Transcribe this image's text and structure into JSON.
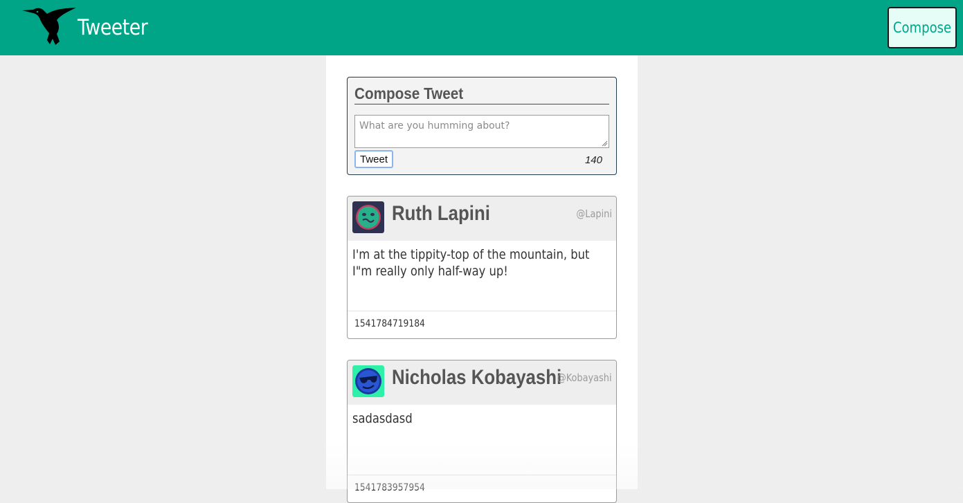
{
  "navbar": {
    "brand": "Tweeter",
    "compose_label": "Compose",
    "logo_icon": "hummingbird-icon",
    "background": "#00a587"
  },
  "compose": {
    "title": "Compose Tweet",
    "placeholder": "What are you humming about?",
    "value": "",
    "submit_label": "Tweet",
    "counter": "140"
  },
  "tweets": [
    {
      "name": "Ruth Lapini",
      "handle": "@Lapini",
      "text": "I'm at the tippity-top of the mountain, but I\"m really only half-way up!",
      "timestamp": "1541784719184",
      "avatar_icon": "smiley-avatar-icon",
      "avatar_bg": "#2e3152",
      "avatar_accent": "#27b18a"
    },
    {
      "name": "Nicholas Kobayashi",
      "handle": "@Kobayashi",
      "text": "sadasdasd",
      "timestamp": "1541783957954",
      "avatar_icon": "sunglasses-avatar-icon",
      "avatar_bg": "#2ef0a8",
      "avatar_accent": "#1f3fb8"
    }
  ]
}
